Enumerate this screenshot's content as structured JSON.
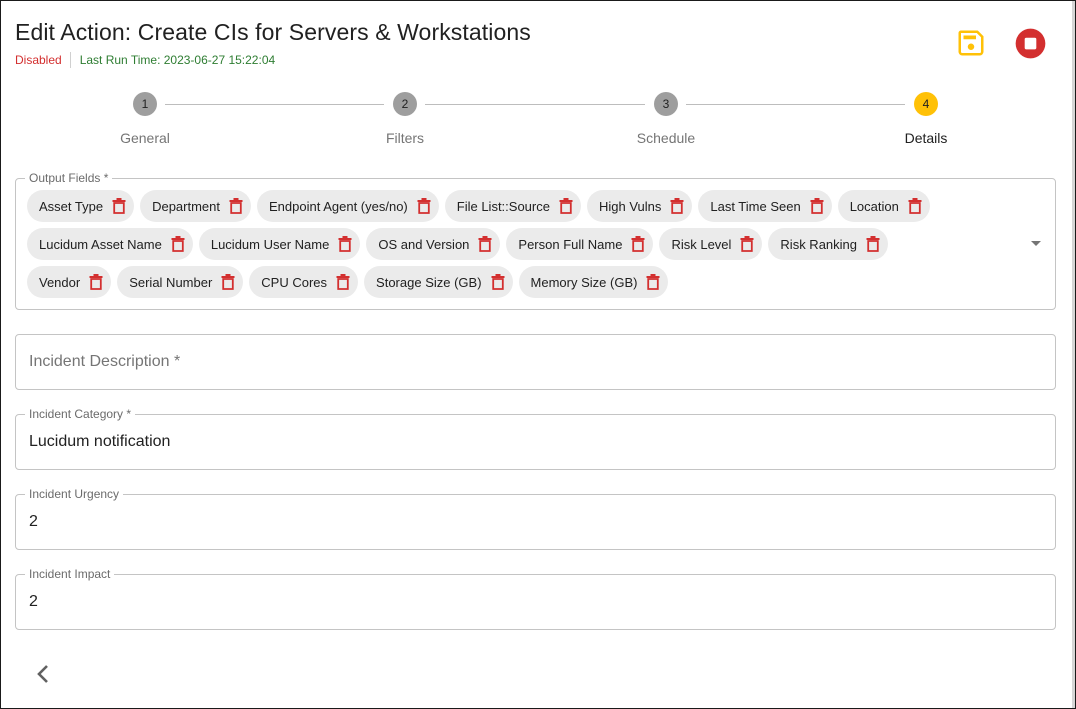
{
  "header": {
    "title": "Edit Action: Create CIs for Servers & Workstations",
    "status": "Disabled",
    "last_run": "Last Run Time: 2023-06-27 15:22:04",
    "save_icon": "floppy-disk-icon",
    "stop_icon": "stop-circle-icon"
  },
  "colors": {
    "accent": "#ffc107",
    "danger": "#d32f2f",
    "success": "#2e7d32",
    "step_inactive": "#9e9e9e",
    "chip_bg": "#ebebeb"
  },
  "stepper": {
    "steps": [
      {
        "number": "1",
        "label": "General"
      },
      {
        "number": "2",
        "label": "Filters"
      },
      {
        "number": "3",
        "label": "Schedule"
      },
      {
        "number": "4",
        "label": "Details"
      }
    ],
    "active_step": 4
  },
  "output_fields": {
    "label": "Output Fields *",
    "chips": [
      "Asset Type",
      "Department",
      "Endpoint Agent (yes/no)",
      "File List::Source",
      "High Vulns",
      "Last Time Seen",
      "Location",
      "Lucidum Asset Name",
      "Lucidum User Name",
      "OS and Version",
      "Person Full Name",
      "Risk Level",
      "Risk Ranking",
      "Vendor",
      "Serial Number",
      "CPU Cores",
      "Storage Size (GB)",
      "Memory Size (GB)"
    ]
  },
  "form": {
    "incident_description": {
      "placeholder": "Incident Description *",
      "value": ""
    },
    "incident_category": {
      "label": "Incident Category *",
      "value": "Lucidum notification"
    },
    "incident_urgency": {
      "label": "Incident Urgency",
      "value": "2"
    },
    "incident_impact": {
      "label": "Incident Impact",
      "value": "2"
    }
  },
  "footer": {
    "back_icon": "chevron-left-icon"
  }
}
